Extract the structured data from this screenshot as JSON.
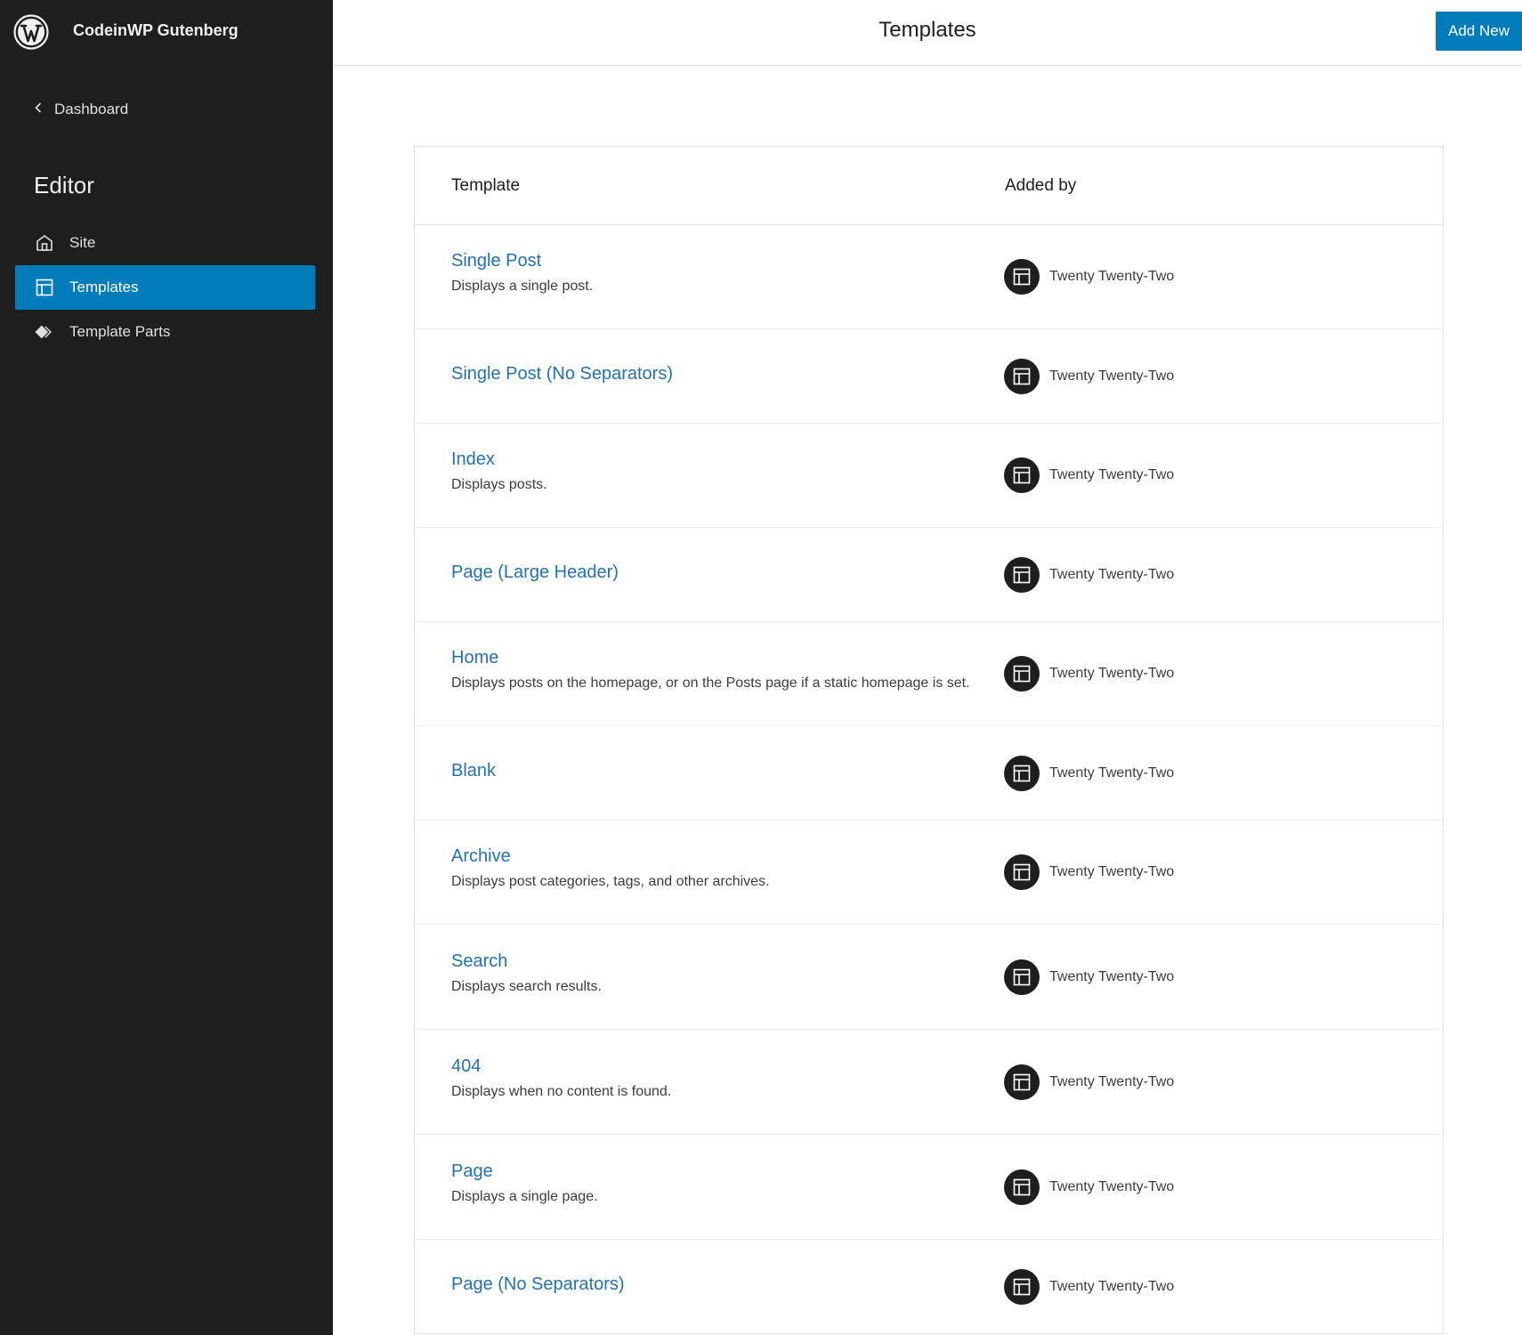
{
  "sidebar": {
    "site_title": "CodeinWP Gutenberg",
    "back_label": "Dashboard",
    "heading": "Editor",
    "items": [
      {
        "label": "Site",
        "icon": "home-icon",
        "active": false
      },
      {
        "label": "Templates",
        "icon": "layout-icon",
        "active": true
      },
      {
        "label": "Template Parts",
        "icon": "symbol-filled-icon",
        "active": false
      }
    ]
  },
  "header": {
    "title": "Templates",
    "add_new_label": "Add New"
  },
  "table": {
    "columns": [
      "Template",
      "Added by"
    ],
    "rows": [
      {
        "name": "Single Post",
        "description": "Displays a single post.",
        "added_by": "Twenty Twenty-Two"
      },
      {
        "name": "Single Post (No Separators)",
        "description": "",
        "added_by": "Twenty Twenty-Two"
      },
      {
        "name": "Index",
        "description": "Displays posts.",
        "added_by": "Twenty Twenty-Two"
      },
      {
        "name": "Page (Large Header)",
        "description": "",
        "added_by": "Twenty Twenty-Two"
      },
      {
        "name": "Home",
        "description": "Displays posts on the homepage, or on the Posts page if a static homepage is set.",
        "added_by": "Twenty Twenty-Two"
      },
      {
        "name": "Blank",
        "description": "",
        "added_by": "Twenty Twenty-Two"
      },
      {
        "name": "Archive",
        "description": "Displays post categories, tags, and other archives.",
        "added_by": "Twenty Twenty-Two"
      },
      {
        "name": "Search",
        "description": "Displays search results.",
        "added_by": "Twenty Twenty-Two"
      },
      {
        "name": "404",
        "description": "Displays when no content is found.",
        "added_by": "Twenty Twenty-Two"
      },
      {
        "name": "Page",
        "description": "Displays a single page.",
        "added_by": "Twenty Twenty-Two"
      },
      {
        "name": "Page (No Separators)",
        "description": "",
        "added_by": "Twenty Twenty-Two"
      }
    ]
  },
  "colors": {
    "sidebar_bg": "#1e1e1e",
    "accent": "#007cba",
    "link": "#2271b1"
  }
}
